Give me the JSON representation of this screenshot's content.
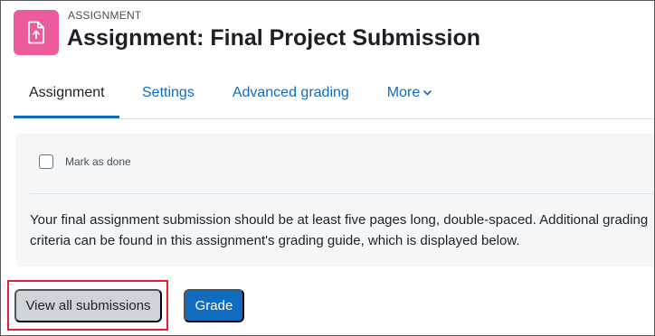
{
  "header": {
    "activity_type": "ASSIGNMENT",
    "title": "Assignment: Final Project Submission",
    "icon": "assignment-upload-icon",
    "icon_color": "#ec5b9c"
  },
  "tabs": [
    {
      "label": "Assignment",
      "active": true
    },
    {
      "label": "Settings",
      "active": false
    },
    {
      "label": "Advanced grading",
      "active": false
    },
    {
      "label": "More",
      "active": false,
      "has_dropdown": true
    }
  ],
  "completion": {
    "label": "Mark as done",
    "checked": false
  },
  "description": "Your final assignment submission should be at least five pages long, double-spaced. Additional grading criteria can be found in this assignment's grading guide, which is displayed below.",
  "actions": {
    "view_all_label": "View all submissions",
    "grade_label": "Grade"
  },
  "colors": {
    "link": "#0f6cbf",
    "primary_button": "#0f6cbf",
    "secondary_button": "#ced4da",
    "highlight_border": "#e3202f"
  }
}
